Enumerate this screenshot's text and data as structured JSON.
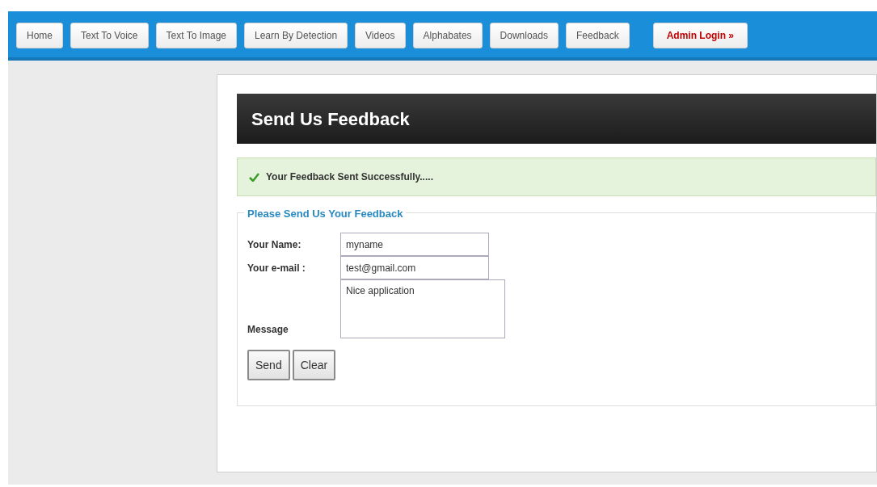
{
  "nav": [
    {
      "label": "Home",
      "kind": "normal"
    },
    {
      "label": "Text To Voice",
      "kind": "normal"
    },
    {
      "label": "Text To Image",
      "kind": "normal"
    },
    {
      "label": "Learn By Detection",
      "kind": "normal"
    },
    {
      "label": "Videos",
      "kind": "normal"
    },
    {
      "label": "Alphabates",
      "kind": "normal"
    },
    {
      "label": "Downloads",
      "kind": "normal"
    },
    {
      "label": "Feedback",
      "kind": "normal"
    },
    {
      "label": "Admin Login »",
      "kind": "admin"
    }
  ],
  "heading": "Send Us Feedback",
  "success": "Your Feedback Sent Successfully.....",
  "form": {
    "legend": "Please Send Us Your Feedback",
    "name_label": "Your Name:",
    "name_value": "myname",
    "email_label": "Your e-mail :",
    "email_value": "test@gmail.com",
    "message_label": "Message",
    "message_value": "Nice application",
    "buttons": [
      "Send",
      "Clear"
    ]
  }
}
